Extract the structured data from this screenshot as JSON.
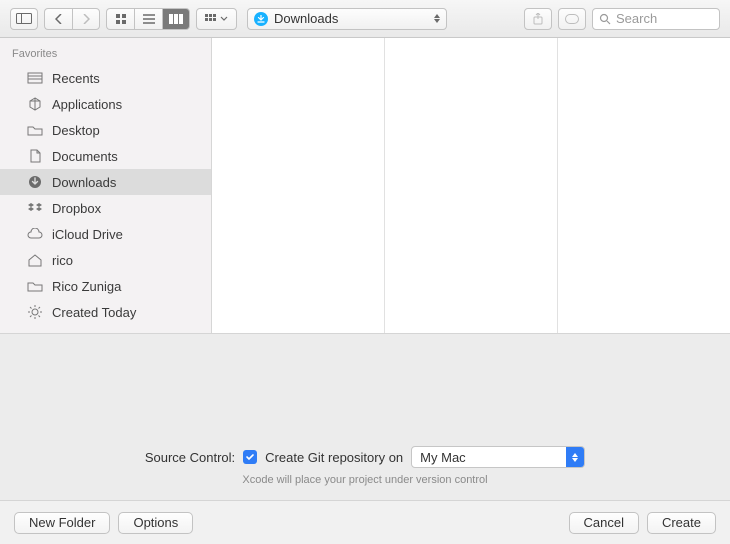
{
  "toolbar": {
    "path_label": "Downloads",
    "search_placeholder": "Search"
  },
  "sidebar": {
    "header": "Favorites",
    "items": [
      {
        "label": "Recents",
        "icon": "recents-icon",
        "selected": false
      },
      {
        "label": "Applications",
        "icon": "apps-icon",
        "selected": false
      },
      {
        "label": "Desktop",
        "icon": "folder-icon",
        "selected": false
      },
      {
        "label": "Documents",
        "icon": "document-icon",
        "selected": false
      },
      {
        "label": "Downloads",
        "icon": "download-icon",
        "selected": true
      },
      {
        "label": "Dropbox",
        "icon": "dropbox-icon",
        "selected": false
      },
      {
        "label": "iCloud Drive",
        "icon": "cloud-icon",
        "selected": false
      },
      {
        "label": "rico",
        "icon": "home-icon",
        "selected": false
      },
      {
        "label": "Rico Zuniga",
        "icon": "folder-icon",
        "selected": false
      },
      {
        "label": "Created Today",
        "icon": "gear-icon",
        "selected": false
      }
    ]
  },
  "source_control": {
    "label": "Source Control:",
    "checkbox_label": "Create Git repository on",
    "checked": true,
    "location": "My Mac",
    "hint": "Xcode will place your project under version control"
  },
  "footer": {
    "new_folder": "New Folder",
    "options": "Options",
    "cancel": "Cancel",
    "create": "Create"
  }
}
